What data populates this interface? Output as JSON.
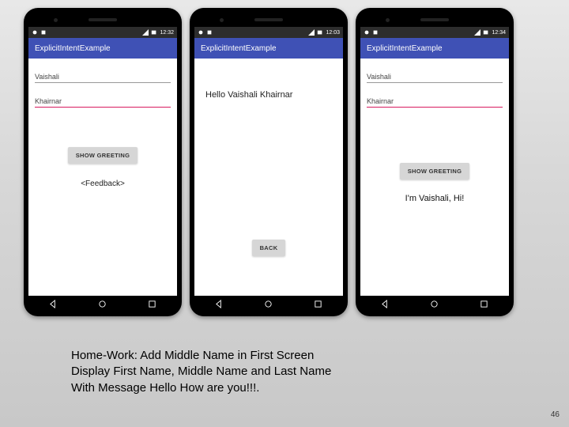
{
  "phone1": {
    "status": {
      "time": "12:32"
    },
    "appbar": {
      "title": "ExplicitIntentExample"
    },
    "firstname": "Vaishali",
    "lastname": "Khairnar",
    "show_btn": "SHOW GREETING",
    "feedback": "<Feedback>"
  },
  "phone2": {
    "status": {
      "time": "12:03"
    },
    "appbar": {
      "title": "ExplicitIntentExample"
    },
    "greeting": "Hello Vaishali Khairnar",
    "back_btn": "BACK"
  },
  "phone3": {
    "status": {
      "time": "12:34"
    },
    "appbar": {
      "title": "ExplicitIntentExample"
    },
    "firstname": "Vaishali",
    "lastname": "Khairnar",
    "show_btn": "SHOW GREETING",
    "result": "I'm Vaishali, Hi!"
  },
  "homework": {
    "line1": "Home-Work: Add Middle Name in First Screen",
    "line2": "Display First Name, Middle Name and Last Name",
    "line3": "With Message Hello How are you!!!."
  },
  "page_number": "46"
}
